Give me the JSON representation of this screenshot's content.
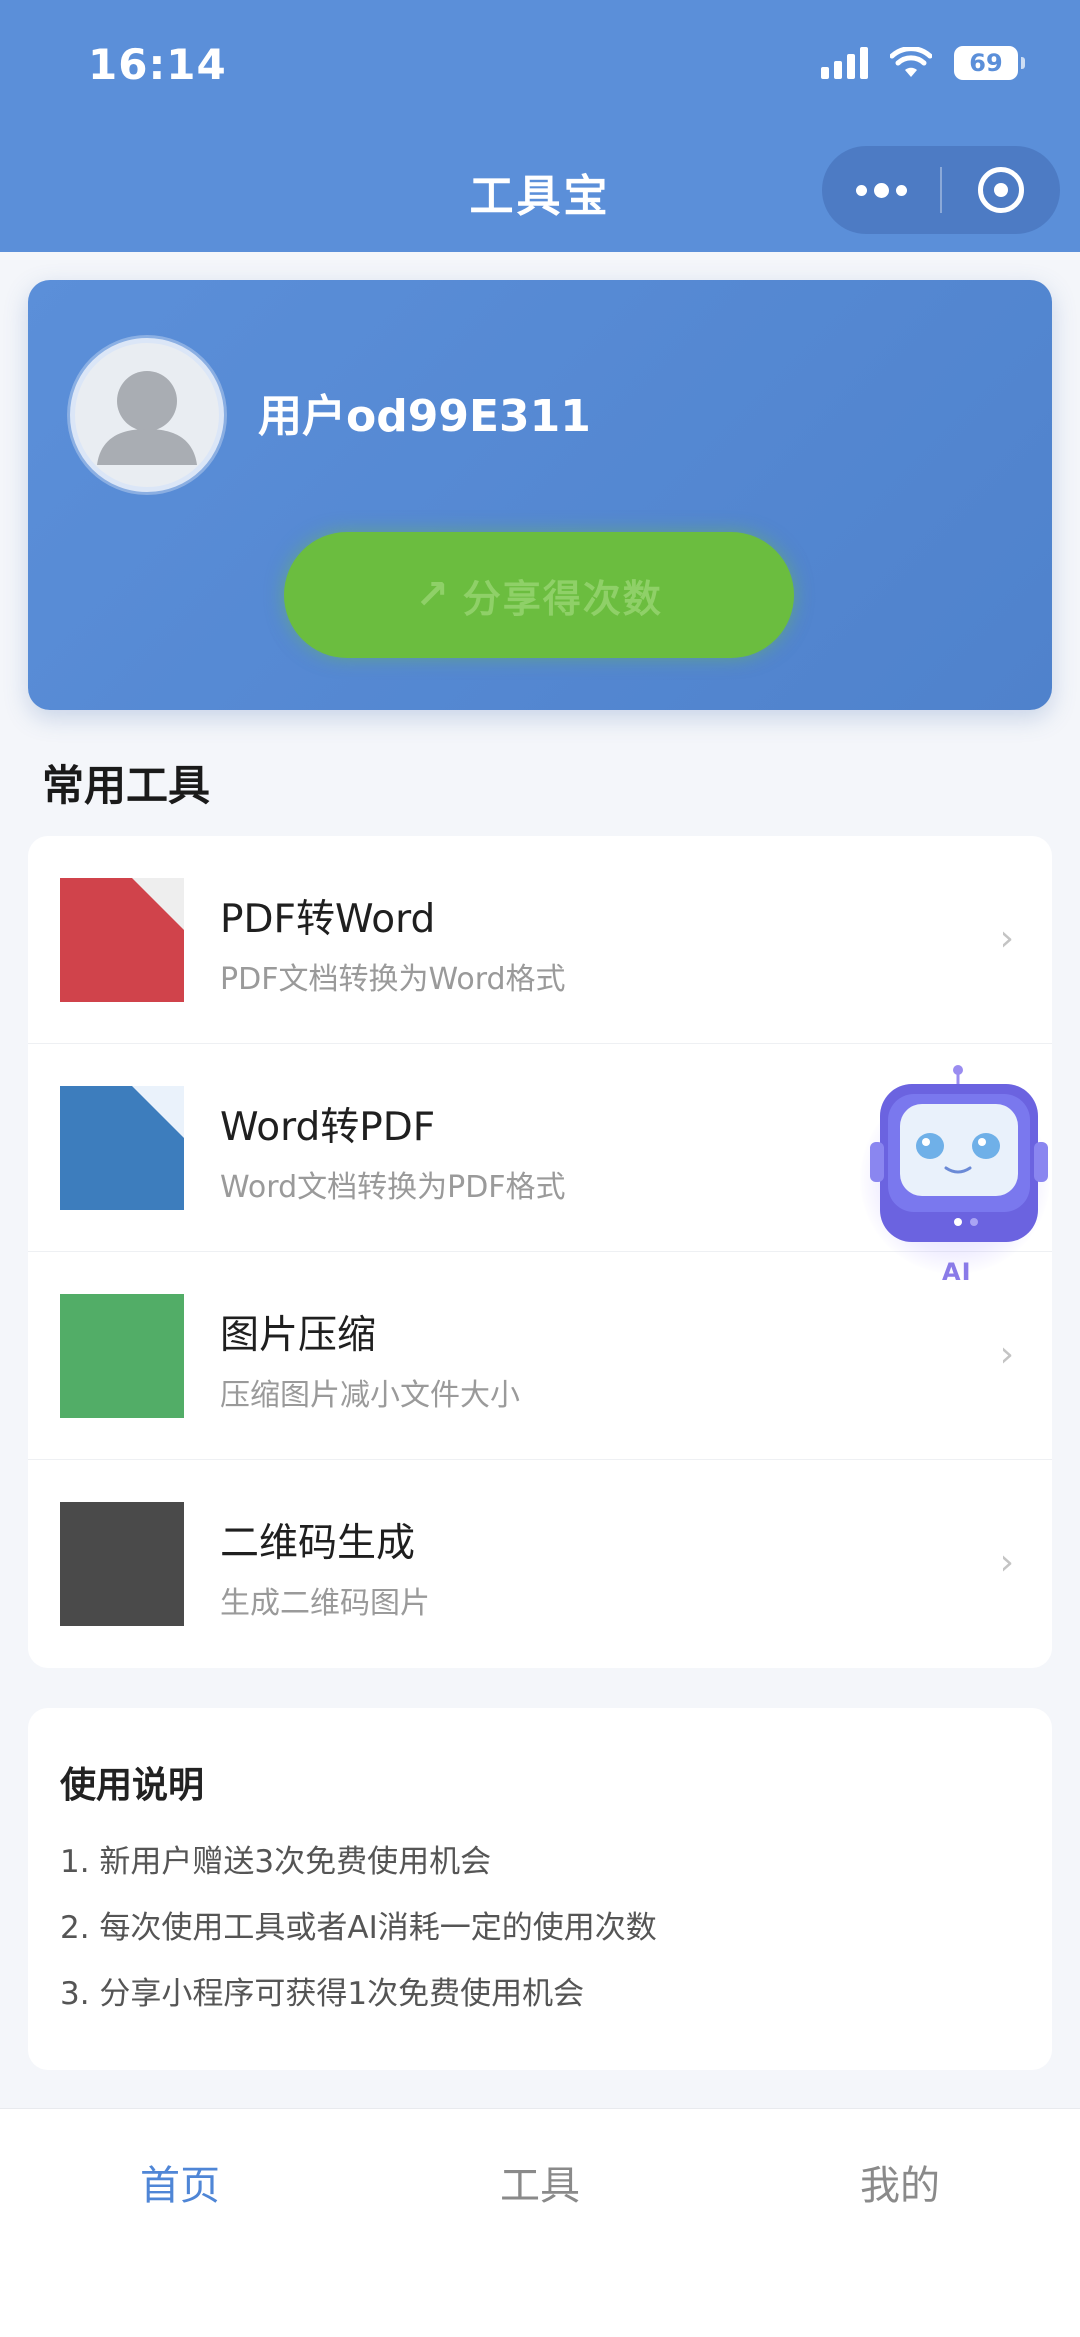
{
  "status_bar": {
    "time": "16:14",
    "battery": "69"
  },
  "nav": {
    "title": "工具宝"
  },
  "profile": {
    "username": "用户od99E311",
    "share_label": "分享得次数"
  },
  "section": {
    "common_tools": "常用工具"
  },
  "tools": [
    {
      "name": "PDF转Word",
      "desc": "PDF文档转换为Word格式",
      "color": "#d0434b"
    },
    {
      "name": "Word转PDF",
      "desc": "Word文档转换为PDF格式",
      "color": "#3d7dbd"
    },
    {
      "name": "图片压缩",
      "desc": "压缩图片减小文件大小",
      "color": "#52ad67"
    },
    {
      "name": "二维码生成",
      "desc": "生成二维码图片",
      "color": "#4a4a4a"
    }
  ],
  "instructions": {
    "title": "使用说明",
    "lines": [
      "1. 新用户赠送3次免费使用机会",
      "2. 每次使用工具或者AI消耗一定的使用次数",
      "3. 分享小程序可获得1次免费使用机会"
    ]
  },
  "ai_button": {
    "label": "AI"
  },
  "tabbar": {
    "tabs": [
      "首页",
      "工具",
      "我的"
    ],
    "active_index": 0
  },
  "colors": {
    "primary": "#5b8fd9",
    "share_green": "#6bbd3f",
    "tab_active": "#4f86d6"
  }
}
